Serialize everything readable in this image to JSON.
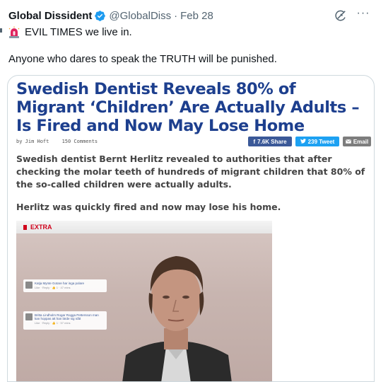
{
  "tweet": {
    "author_name": "Global Dissident",
    "author_handle": "@GlobalDiss",
    "separator": "·",
    "date": "Feb 28",
    "line1_text": "EVIL TIMES we live in.",
    "line2_text": "Anyone who dares to speak the TRUTH will be punished.",
    "more_label": "···",
    "icons": {
      "verified": "verified-badge-icon",
      "siren": "rotating-light-emoji",
      "grok": "grok-icon",
      "more": "more-dots-icon"
    },
    "colors": {
      "verified": "#1d9bf0",
      "handle": "#536471",
      "text": "#0f1419"
    }
  },
  "article": {
    "title": "Swedish Dentist Reveals 80% of Migrant ‘Children’ Are Actually Adults – Is Fired and Now May Lose Home",
    "byline_author": "by Jim Hoft",
    "byline_comments": "150 Comments",
    "share_facebook": "7.6K Share",
    "share_twitter": "239 Tweet",
    "share_email": "Email",
    "paragraph1": "Swedish dentist Bernt Herlitz revealed to authorities that after checking the molar teeth of hundreds of migrant children that 80% of the so-called children were actually adults.",
    "paragraph2": "Herlitz was quickly fired and now may lose his home.",
    "extra_label": "EXTRA",
    "comment1_text": "Katja Mynte Gotare har inga polare",
    "comment1_meta": "Like · Reply · 👍 1 · 47 mins",
    "comment2_text": "Britta Lindholm Rogar Rogga Pettersson man kan hoppas att han lärde sig nått",
    "comment2_meta": "Like · Reply · 👍 1 · 57 mins",
    "colors": {
      "title": "#1d3f8e",
      "facebook": "#3b5998",
      "twitter": "#1da1f2",
      "email": "#7d7d7d",
      "extra": "#d0021b"
    }
  }
}
